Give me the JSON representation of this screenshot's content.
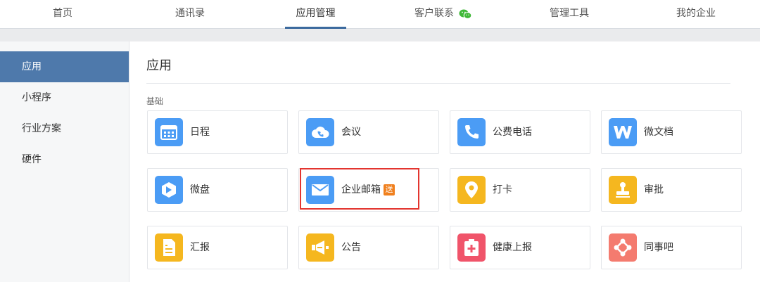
{
  "topnav": {
    "tabs": [
      {
        "label": "首页"
      },
      {
        "label": "通讯录"
      },
      {
        "label": "应用管理"
      },
      {
        "label": "客户联系"
      },
      {
        "label": "管理工具"
      },
      {
        "label": "我的企业"
      }
    ],
    "active_tab": "应用管理"
  },
  "sidebar": {
    "items": [
      {
        "label": "应用"
      },
      {
        "label": "小程序"
      },
      {
        "label": "行业方案"
      },
      {
        "label": "硬件"
      }
    ],
    "active_item": "应用"
  },
  "main": {
    "title": "应用",
    "section_label": "基础",
    "apps": [
      {
        "label": "日程",
        "icon": "calendar-icon",
        "color": "#4b9cf5"
      },
      {
        "label": "会议",
        "icon": "cloud-phone-icon",
        "color": "#4b9cf5"
      },
      {
        "label": "公费电话",
        "icon": "phone-icon",
        "color": "#4b9cf5"
      },
      {
        "label": "微文档",
        "icon": "w-doc-icon",
        "color": "#4b9cf5"
      },
      {
        "label": "微盘",
        "icon": "drive-icon",
        "color": "#4b9cf5"
      },
      {
        "label": "企业邮箱",
        "icon": "mail-icon",
        "color": "#4b9cf5",
        "badge": "送"
      },
      {
        "label": "打卡",
        "icon": "location-pin-icon",
        "color": "#f5b71f"
      },
      {
        "label": "审批",
        "icon": "stamp-icon",
        "color": "#f5b71f"
      },
      {
        "label": "汇报",
        "icon": "report-icon",
        "color": "#f5b71f"
      },
      {
        "label": "公告",
        "icon": "megaphone-icon",
        "color": "#f5b71f"
      },
      {
        "label": "健康上报",
        "icon": "health-kit-icon",
        "color": "#f0546a"
      },
      {
        "label": "同事吧",
        "icon": "network-icon",
        "color": "#f47b6f"
      }
    ]
  },
  "colors": {
    "nav_active_underline": "#3b6a9e",
    "sidebar_active": "#4e79ab",
    "highlight": "#e3352f",
    "badge": "#f0801e",
    "wechat_green": "#3fb837"
  }
}
